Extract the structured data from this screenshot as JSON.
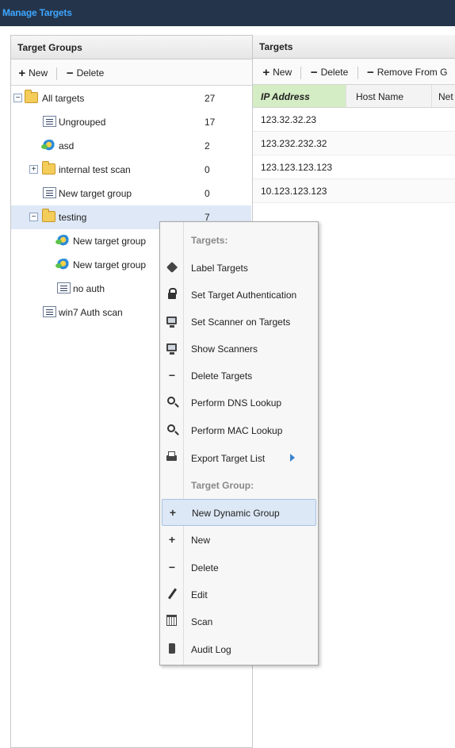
{
  "window": {
    "title": "Manage Targets"
  },
  "target_groups": {
    "header": "Target Groups",
    "toolbar": {
      "new_label": "New",
      "delete_label": "Delete"
    },
    "items": [
      {
        "label": "All targets",
        "count": "27"
      },
      {
        "label": "Ungrouped",
        "count": "17"
      },
      {
        "label": "asd",
        "count": "2"
      },
      {
        "label": "internal test scan",
        "count": "0"
      },
      {
        "label": "New target group",
        "count": "0"
      },
      {
        "label": "testing",
        "count": "7"
      },
      {
        "label": "New target group",
        "count": ""
      },
      {
        "label": "New target group",
        "count": ""
      },
      {
        "label": "no auth",
        "count": ""
      },
      {
        "label": "win7 Auth scan",
        "count": ""
      }
    ]
  },
  "targets": {
    "header": "Targets",
    "toolbar": {
      "new_label": "New",
      "delete_label": "Delete",
      "remove_label": "Remove From G"
    },
    "columns": [
      "IP Address",
      "Host Name",
      "Net"
    ],
    "rows": [
      "123.32.32.23",
      "123.232.232.32",
      "123.123.123.123",
      "10.123.123.123"
    ]
  },
  "context_menu": {
    "targets_header": "Targets:",
    "label_targets": "Label Targets",
    "set_target_auth": "Set Target Authentication",
    "set_scanner": "Set Scanner on Targets",
    "show_scanners": "Show Scanners",
    "delete_targets": "Delete Targets",
    "dns_lookup": "Perform DNS Lookup",
    "mac_lookup": "Perform MAC Lookup",
    "export_list": "Export Target List",
    "group_header": "Target Group:",
    "new_dynamic_group": "New Dynamic Group",
    "new": "New",
    "delete": "Delete",
    "edit": "Edit",
    "scan": "Scan",
    "audit_log": "Audit Log"
  },
  "colors": {
    "title_bg": "#24344a",
    "title_text": "#3ea6ff",
    "selection": "#dfe8f6",
    "active_column": "#d4edc4",
    "menu_hover": "#dde8f6"
  }
}
